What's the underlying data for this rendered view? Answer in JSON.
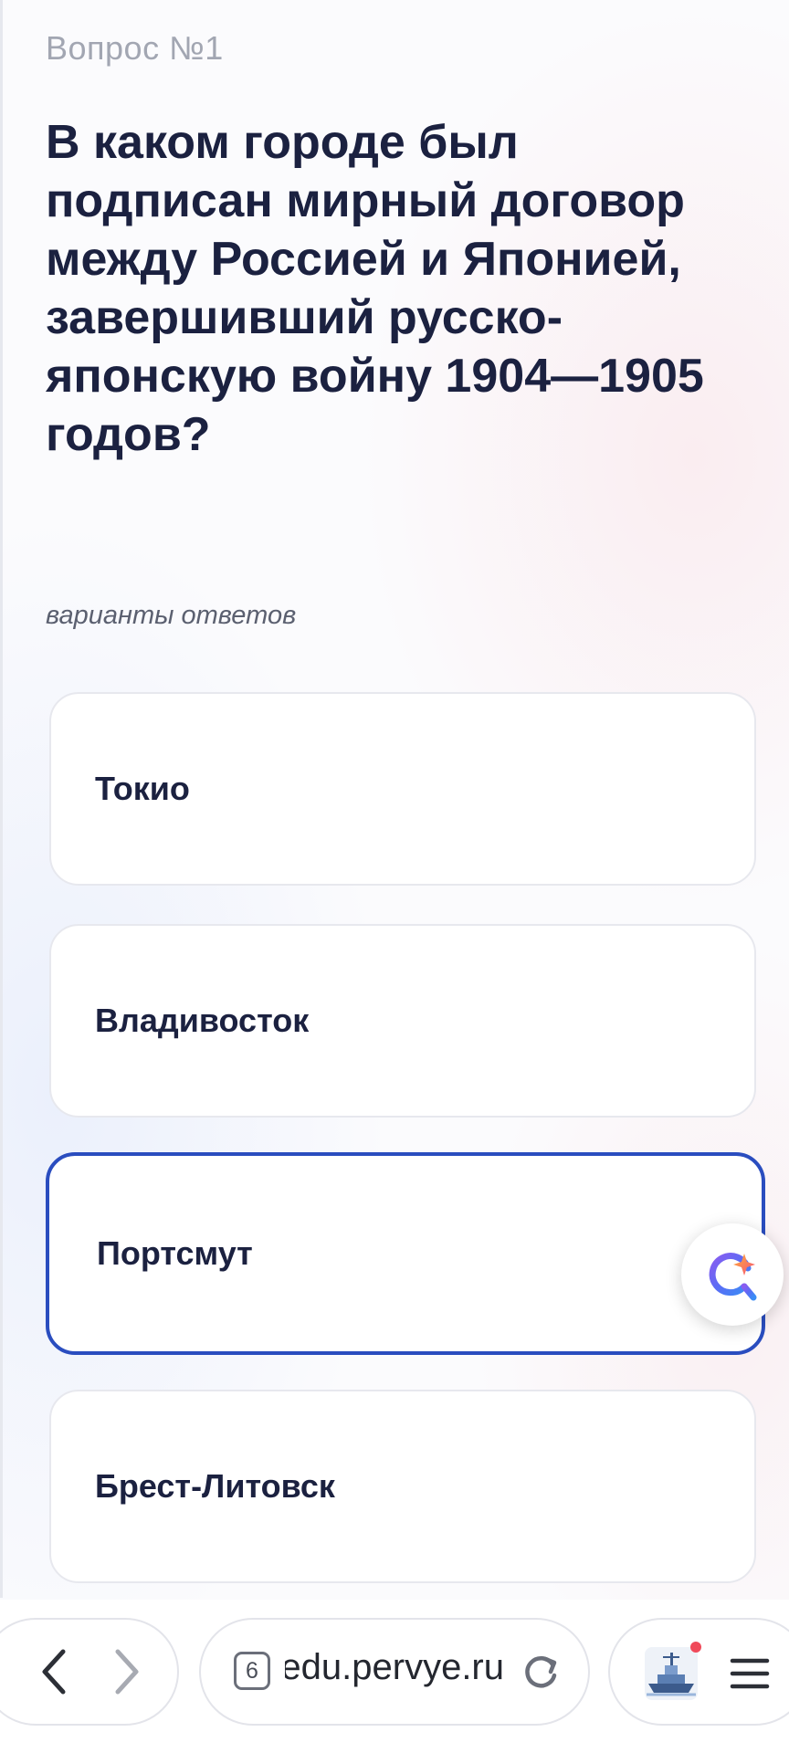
{
  "question": {
    "number_label": "Вопрос №1",
    "text": "В каком городе был подписан мирный договор между Россией и Японией, завершивший русско-японскую войну 1904—1905 годов?"
  },
  "answers_label": "варианты ответов",
  "answers": [
    {
      "label": "Токио",
      "selected": false
    },
    {
      "label": "Владивосток",
      "selected": false
    },
    {
      "label": "Портсмут",
      "selected": true
    },
    {
      "label": "Брест-Литовск",
      "selected": false
    }
  ],
  "browser": {
    "tab_count": "6",
    "url": "edu.pervye.ru",
    "accent_color": "#2a4dbf",
    "icons": [
      "back-arrow-icon",
      "forward-arrow-icon",
      "tab-count-icon",
      "reload-icon",
      "ship-icon",
      "menu-icon",
      "ai-assistant-icon"
    ]
  },
  "colors": {
    "text_primary": "#1b2140",
    "text_muted": "#a2a6b2",
    "selected_border": "#2a4dbf",
    "notification_dot": "#f04a5a"
  }
}
